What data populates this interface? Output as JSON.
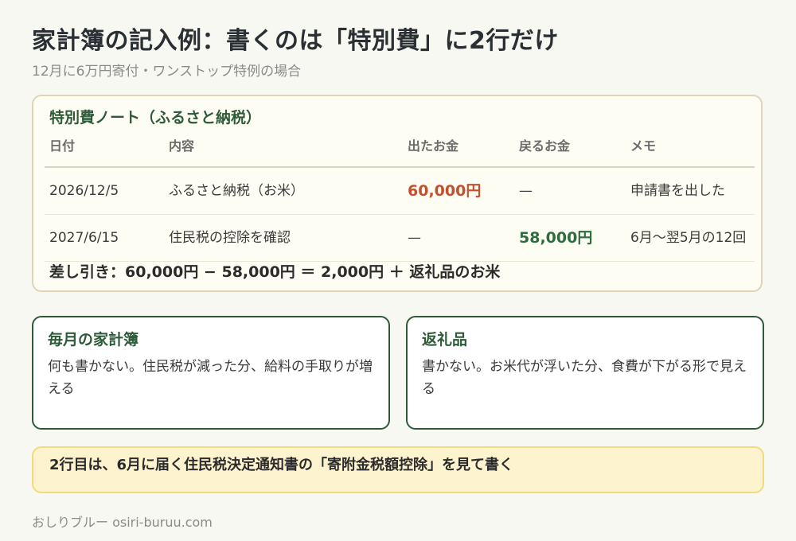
{
  "title": "家計簿の記入例：書くのは「特別費」に2行だけ",
  "subtitle": "12月に6万円寄付・ワンストップ特例の場合",
  "note": {
    "title": "特別費ノート（ふるさと納税）",
    "headers": [
      "日付",
      "内容",
      "出たお金",
      "戻るお金",
      "メモ"
    ],
    "rows": [
      [
        "2026/12/5",
        "ふるさと納税（お米）",
        "60,000円",
        "—",
        "申請書を出した"
      ],
      [
        "2027/6/15",
        "住民税の控除を確認",
        "—",
        "58,000円",
        "6月～翌5月の12回"
      ]
    ],
    "summary": "差し引き：60,000円 − 58,000円 ＝ 2,000円 ＋ 返礼品のお米"
  },
  "cards": [
    {
      "title": "毎月の家計簿",
      "body": "何も書かない。住民税が減った分、給料の手取りが増える"
    },
    {
      "title": "返礼品",
      "body": "書かない。お米代が浮いた分、食費が下がる形で見える"
    }
  ],
  "callout": "2行目は、6月に届く住民税決定通知書の「寄附金税額控除」を見て書く",
  "footer": "おしりブルー osiri-buruu.com",
  "colors": {
    "accent_green": "#2e5a3a",
    "money_out": "#c4502d",
    "money_in": "#2e6b3d",
    "callout_bg": "#fdf4cf"
  }
}
